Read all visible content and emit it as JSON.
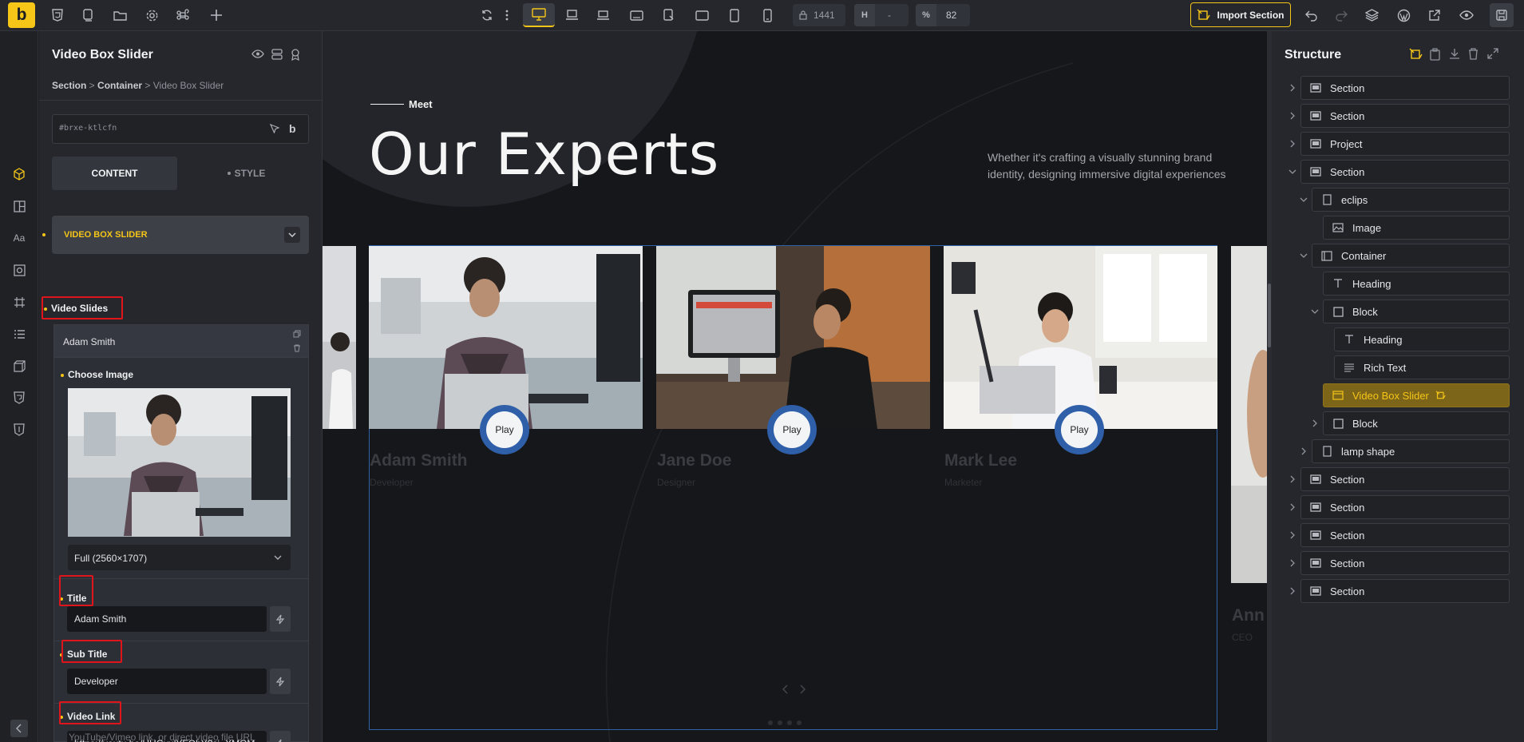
{
  "toolbar": {
    "logo": "b",
    "width_value": "1441",
    "height_label": "H",
    "height_value": "-",
    "zoom_label": "%",
    "zoom_value": "82",
    "import_label": "Import Section"
  },
  "panel": {
    "title": "Video Box Slider",
    "breadcrumb": [
      "Section",
      "Container",
      "Video Box Slider"
    ],
    "element_id": "#brxe-ktlcfn",
    "id_suffix": "b",
    "tabs": {
      "content": "CONTENT",
      "style": "STYLE"
    },
    "group_title": "VIDEO BOX SLIDER",
    "video_slides_label": "Video Slides",
    "slide_name": "Adam Smith",
    "choose_image_label": "Choose Image",
    "image_size": "Full (2560×1707)",
    "title_label": "Title",
    "title_value": "Adam Smith",
    "subtitle_label": "Sub Title",
    "subtitle_value": "Developer",
    "video_link_label": "Video Link",
    "video_link_value": "https://youtu.be/HHGyulYFQbY?si=XMOM",
    "video_link_help": "YouTube/Vimeo link, or direct video file URL"
  },
  "canvas": {
    "kicker": "Meet",
    "heading": "Our Experts",
    "description": "Whether it's crafting a visually stunning brand identity, designing immersive digital experiences",
    "play_label": "Play",
    "cards": [
      {
        "name": "Adam Smith",
        "role": "Developer"
      },
      {
        "name": "Jane Doe",
        "role": "Designer"
      },
      {
        "name": "Mark Lee",
        "role": "Marketer"
      }
    ],
    "partial_card": {
      "name": "Ann",
      "role": "CEO"
    }
  },
  "structure": {
    "title": "Structure",
    "items": [
      {
        "label": "Section",
        "icon": "section-icon"
      },
      {
        "label": "Section",
        "icon": "section-icon"
      },
      {
        "label": "Project",
        "icon": "section-icon"
      },
      {
        "label": "Section",
        "icon": "section-icon"
      },
      {
        "label": "eclips",
        "icon": "div-icon"
      },
      {
        "label": "Image",
        "icon": "image-icon"
      },
      {
        "label": "Container",
        "icon": "container-icon"
      },
      {
        "label": "Heading",
        "icon": "heading-icon"
      },
      {
        "label": "Block",
        "icon": "block-icon"
      },
      {
        "label": "Heading",
        "icon": "heading-icon"
      },
      {
        "label": "Rich Text",
        "icon": "rich-text-icon"
      },
      {
        "label": "Video Box Slider",
        "icon": "video-box-icon",
        "selected": true
      },
      {
        "label": "Block",
        "icon": "block-icon"
      },
      {
        "label": "lamp shape",
        "icon": "div-icon"
      },
      {
        "label": "Section",
        "icon": "section-icon"
      },
      {
        "label": "Section",
        "icon": "section-icon"
      },
      {
        "label": "Section",
        "icon": "section-icon"
      },
      {
        "label": "Section",
        "icon": "section-icon"
      },
      {
        "label": "Section",
        "icon": "section-icon"
      }
    ]
  },
  "colors": {
    "accent": "#f5c518",
    "highlight": "#e0151b",
    "play_ring": "#2f5fa8"
  }
}
